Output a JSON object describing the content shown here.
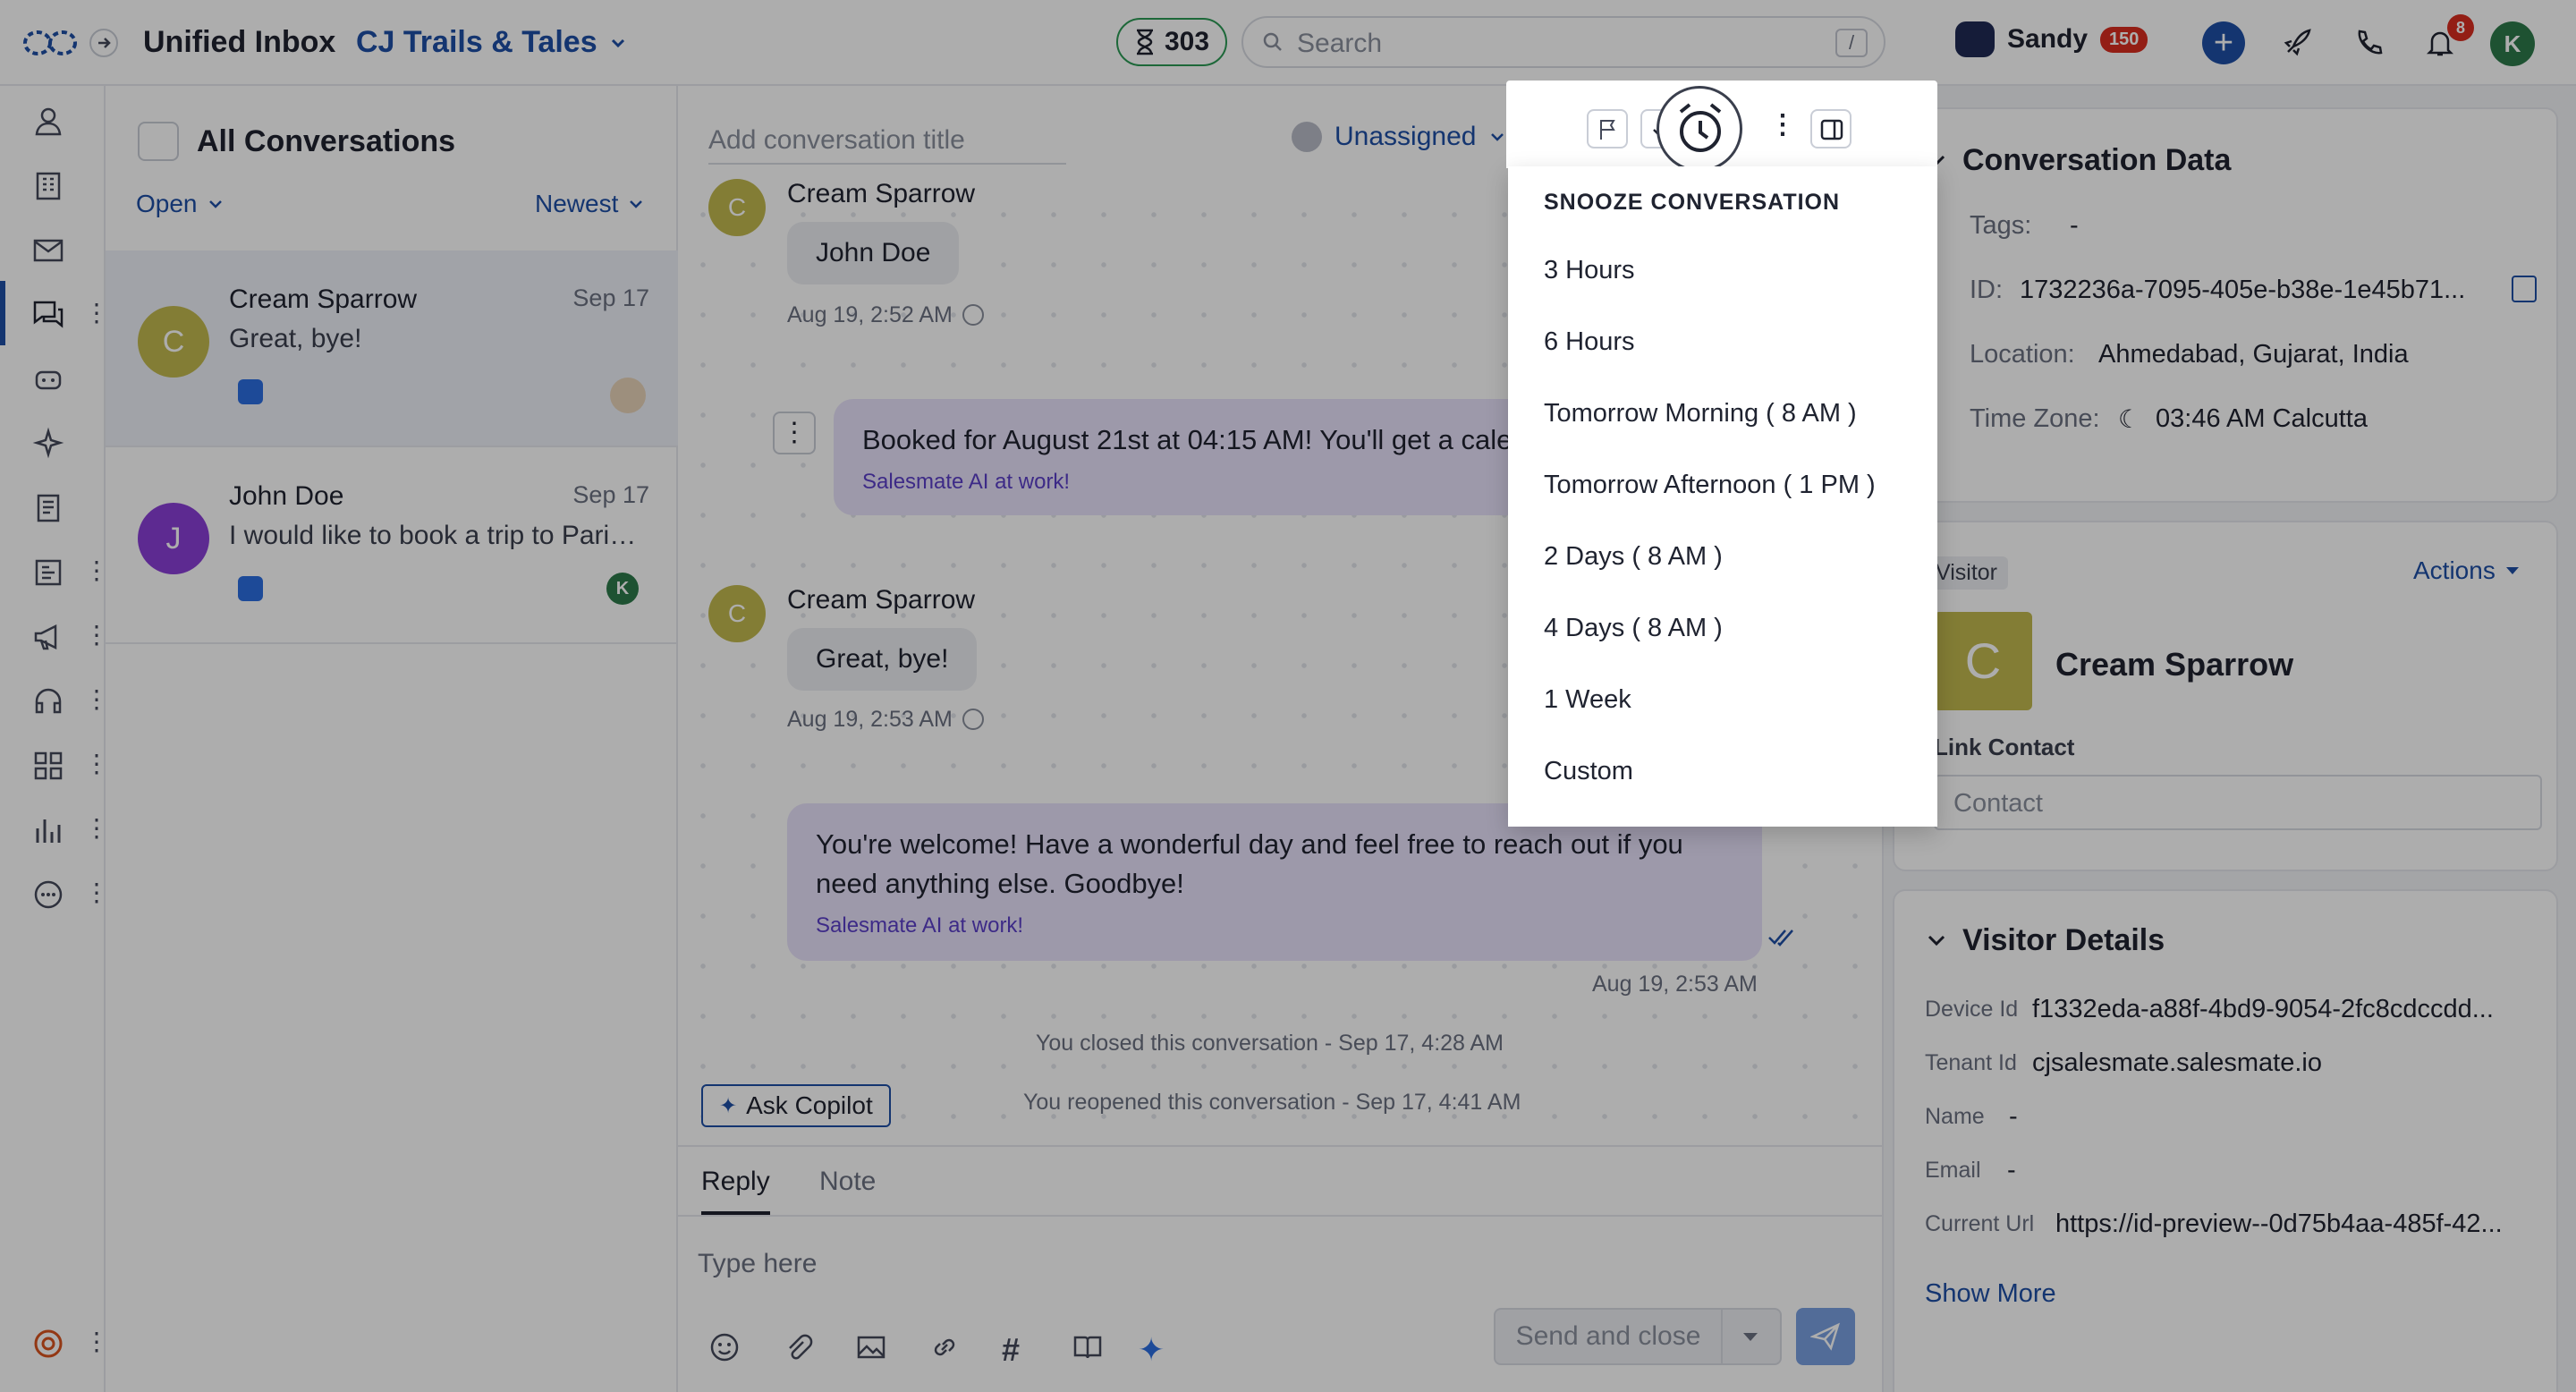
{
  "topbar": {
    "title": "Unified Inbox",
    "workspace": "CJ Trails & Tales",
    "counter": "303",
    "search_placeholder": "Search",
    "search_shortcut": "/",
    "user_name": "Sandy",
    "user_badge": "150",
    "notifications_count": "8",
    "avatar_initial": "K"
  },
  "list": {
    "title": "All Conversations",
    "status_filter": "Open",
    "sort": "Newest",
    "conversations": [
      {
        "initial": "C",
        "name": "Cream Sparrow",
        "date": "Sep 17",
        "preview": "Great, bye!",
        "avatar_color": "#c2b84f",
        "assignee": ""
      },
      {
        "initial": "J",
        "name": "John Doe",
        "date": "Sep 17",
        "preview": "I would like to book a trip to Paris ...",
        "avatar_color": "#8a3fd6",
        "assignee": "K"
      }
    ]
  },
  "chat": {
    "title_placeholder": "Add conversation title",
    "assignee": "Unassigned",
    "messages": [
      {
        "author": "Cream Sparrow",
        "initial": "C",
        "text": "John Doe",
        "meta": "Aug 19, 2:52 AM"
      },
      {
        "text": "Booked for August 21st at 04:15 AM! You'll get a cale",
        "ai_label": "Salesmate AI at work!"
      },
      {
        "author": "Cream Sparrow",
        "initial": "C",
        "text": "Great, bye!",
        "meta": "Aug 19, 2:53 AM"
      },
      {
        "text": "You're welcome! Have a wonderful day and feel free to reach out if you need anything else. Goodbye!",
        "ai_label": "Salesmate AI at work!",
        "meta": "Aug 19, 2:53 AM"
      }
    ],
    "system_closed": "You closed this conversation - Sep 17, 4:28 AM",
    "system_reopened": "You reopened this conversation - Sep 17, 4:41 AM",
    "copilot": "Ask Copilot",
    "tabs": [
      "Reply",
      "Note"
    ],
    "composer_placeholder": "Type here",
    "send_close": "Send and close"
  },
  "right": {
    "conversation_data": {
      "title": "Conversation Data",
      "tags_label": "Tags:",
      "tags_value": "-",
      "id_label": "ID:",
      "id_value": "1732236a-7095-405e-b38e-1e45b71...",
      "location_label": "Location:",
      "location_value": "Ahmedabad, Gujarat, India",
      "timezone_label": "Time Zone:",
      "timezone_value": "03:46 AM Calcutta"
    },
    "visitor": {
      "badge": "Visitor",
      "actions": "Actions",
      "initial": "C",
      "name": "Cream Sparrow",
      "link_label": "Link Contact",
      "contact_placeholder": "Contact"
    },
    "visitor_details": {
      "title": "Visitor Details",
      "rows": [
        {
          "label": "Device Id",
          "value": "f1332eda-a88f-4bd9-9054-2fc8cdccdd..."
        },
        {
          "label": "Tenant Id",
          "value": "cjsalesmate.salesmate.io"
        },
        {
          "label": "Name",
          "value": "-"
        },
        {
          "label": "Email",
          "value": "-"
        },
        {
          "label": "Current Url",
          "value": "https://id-preview--0d75b4aa-485f-42..."
        }
      ],
      "show_more": "Show More"
    }
  },
  "snooze": {
    "header": "SNOOZE CONVERSATION",
    "options": [
      "3 Hours",
      "6 Hours",
      "Tomorrow Morning ( 8 AM )",
      "Tomorrow Afternoon ( 1 PM )",
      "2 Days ( 8 AM )",
      "4 Days ( 8 AM )",
      "1 Week",
      "Custom"
    ]
  },
  "colors": {
    "accent": "#1e4fa5",
    "ai_bubble": "#e8e2fb",
    "danger": "#d92d20",
    "success": "#2b9a55"
  }
}
